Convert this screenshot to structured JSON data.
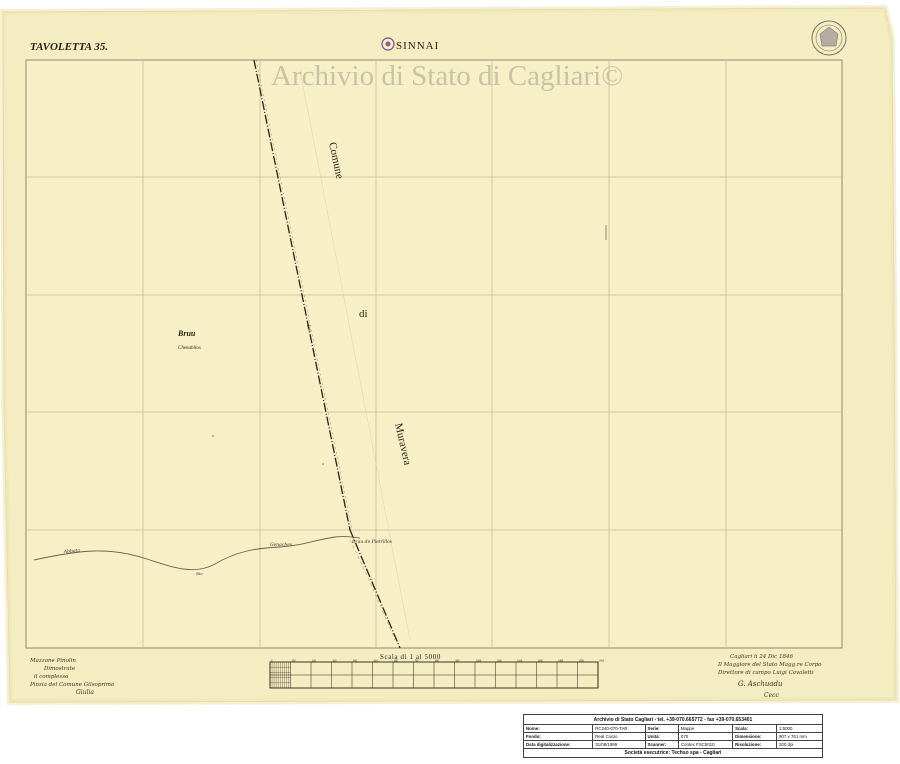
{
  "sheet": {
    "tavoletta": "TAVOLETTA 35.",
    "place_name": "SINNAI",
    "watermark": "Archivio di Stato di Cagliari©",
    "comune_words": [
      "Comune",
      "di",
      "Muravera"
    ],
    "region_label": "Bruu",
    "region_sublabel": "Chenabllos",
    "river_labels": [
      "Abbata",
      "Rio",
      "Genaches",
      "Bruu de Pietrillos"
    ],
    "boundary_label": "Lim",
    "scale_label": "Scala di 1 al 5000",
    "scale_ticks": [
      "0",
      "100",
      "200",
      "300",
      "400",
      "500",
      "600",
      "700",
      "800",
      "900",
      "1000",
      "1100",
      "1200",
      "1300",
      "1400",
      "1500",
      "1600"
    ],
    "signature_left": [
      "Mazzone Pinolin",
      "Dimostrate",
      "il complesso",
      "Pinzia del Comune Gilsoprimo",
      "Giulia"
    ],
    "signature_right": [
      "Cagliari li 24 Dic 1846",
      "Il Maggiore del Stato Magg.re Corpo",
      "Direttore di campo Luigi Cavaletti",
      "G. Aschuadu",
      "Cecc"
    ],
    "colors": {
      "paper": "#f6efc3",
      "ink": "#2a2218",
      "grid": "#cbb89a",
      "border": "#8a7d6a"
    }
  },
  "info_panel": {
    "header": "Archivio di Stato Cagliari - tel. +39-070.665772 - fax +39-070.653401",
    "rows": [
      [
        {
          "k": "Nome:",
          "v": "RC240-070-TAR"
        },
        {
          "k": "Serie:",
          "v": "Mappe"
        },
        {
          "k": "Scala:",
          "v": "1:5000"
        }
      ],
      [
        {
          "k": "Fondo:",
          "v": "Real Corpo"
        },
        {
          "k": "Unità:",
          "v": "070"
        },
        {
          "k": "Dimensione:",
          "v": "907 x 761 mm"
        }
      ],
      [
        {
          "k": "Data digitalizzazione:",
          "v": "31/08/1999"
        },
        {
          "k": "Scanner:",
          "v": "Contex FSC5010"
        },
        {
          "k": "Risoluzione:",
          "v": "200 dpi"
        }
      ]
    ],
    "footer": "Società esecutrice: Techso spa - Cagliari"
  }
}
